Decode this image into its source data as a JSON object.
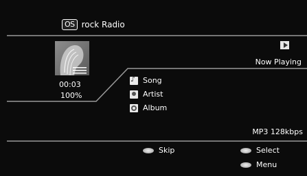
{
  "header": {
    "logo": "OS",
    "station": "rock Radio"
  },
  "playback": {
    "time": "00:03",
    "buffer": "100%",
    "status": "Now Playing",
    "status_icon": "play-icon"
  },
  "track": {
    "song": "Song",
    "artist": "Artist",
    "album": "Album"
  },
  "stream": {
    "format": "MP3 128kbps"
  },
  "footer": {
    "skip_label": "Skip",
    "select_label": "Select",
    "menu_label": "Menu"
  }
}
